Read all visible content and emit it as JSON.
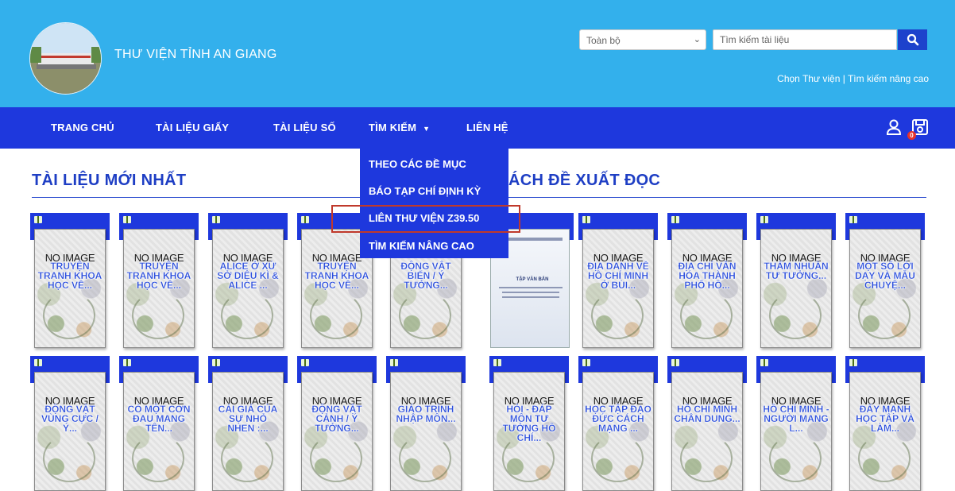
{
  "header": {
    "site_title": "THƯ VIỆN TỈNH AN GIANG",
    "scope_select": "Toàn bộ",
    "search_placeholder": "Tìm kiếm tài liệu",
    "link_choose_library": "Chọn Thư viện",
    "link_separator": " | ",
    "link_advanced_search": "Tìm kiếm nâng cao"
  },
  "nav": {
    "home": "TRANG CHỦ",
    "paper_docs": "TÀI LIỆU GIẤY",
    "digital_docs": "TÀI LIỆU SỐ",
    "search": "TÌM KIẾM",
    "contact": "LIÊN HỆ",
    "cart_count": "0"
  },
  "dropdown": {
    "items": [
      "THEO CÁC ĐỀ MỤC",
      "BÁO TẠP CHÍ ĐỊNH KỲ",
      "LIÊN THƯ VIỆN Z39.50",
      "TÌM KIẾM NÂNG CAO"
    ]
  },
  "sections": {
    "newest": "TÀI LIỆU MỚI NHẤT",
    "recommended": "ÁCH ĐỀ XUẤT ĐỌC"
  },
  "placeholder_text": "NO IMAGE",
  "newest_row1": [
    "TRUYỆN TRANH KHOA HỌC VỀ...",
    "TRUYỆN TRANH KHOA HỌC VỀ...",
    "ALICE Ở XỨ SỞ DIỆU KÌ & ALICE ...",
    "TRUYỆN TRANH KHOA HỌC VỀ...",
    "ĐỘNG VẬT BIỂN / Ý TƯỞNG..."
  ],
  "newest_row2": [
    "ĐỘNG VẬT VÙNG CỰC / Ý...",
    "CÓ MỘT CƠN ĐAU MANG TÊN...",
    "CÁI GIÁ CỦA SỰ NHỎ NHEN :...",
    "ĐỘNG VẬT CẢNH / Ý TƯỞNG...",
    "GIÁO TRÌNH NHẬP MÔN..."
  ],
  "recommended_row1": [
    "",
    "ĐỊA DANH VỀ HỒ CHÍ MINH Ở BÙI...",
    "ĐỊA CHÍ VĂN HÓA THÀNH PHỐ HỒ...",
    "THẨM NHUẦN TƯ TƯỞNG...",
    "MỘT SỐ LỜI DẠY VÀ MẪU CHUYỆ..."
  ],
  "recommended_row2": [
    "HỎI - ĐÁP MÔN TƯ TƯỞNG HỒ CHÍ...",
    "HỌC TẬP ĐẠO ĐỨC CÁCH MẠNG ...",
    "HỒ CHÍ MINH CHÂN DUNG...",
    "HỒ CHÍ MINH - NGƯỜI MANG L...",
    "ĐẨY MẠNH HỌC TẬP VÀ LÀM..."
  ],
  "real_cover_title": "TẬP VĂN BẢN"
}
